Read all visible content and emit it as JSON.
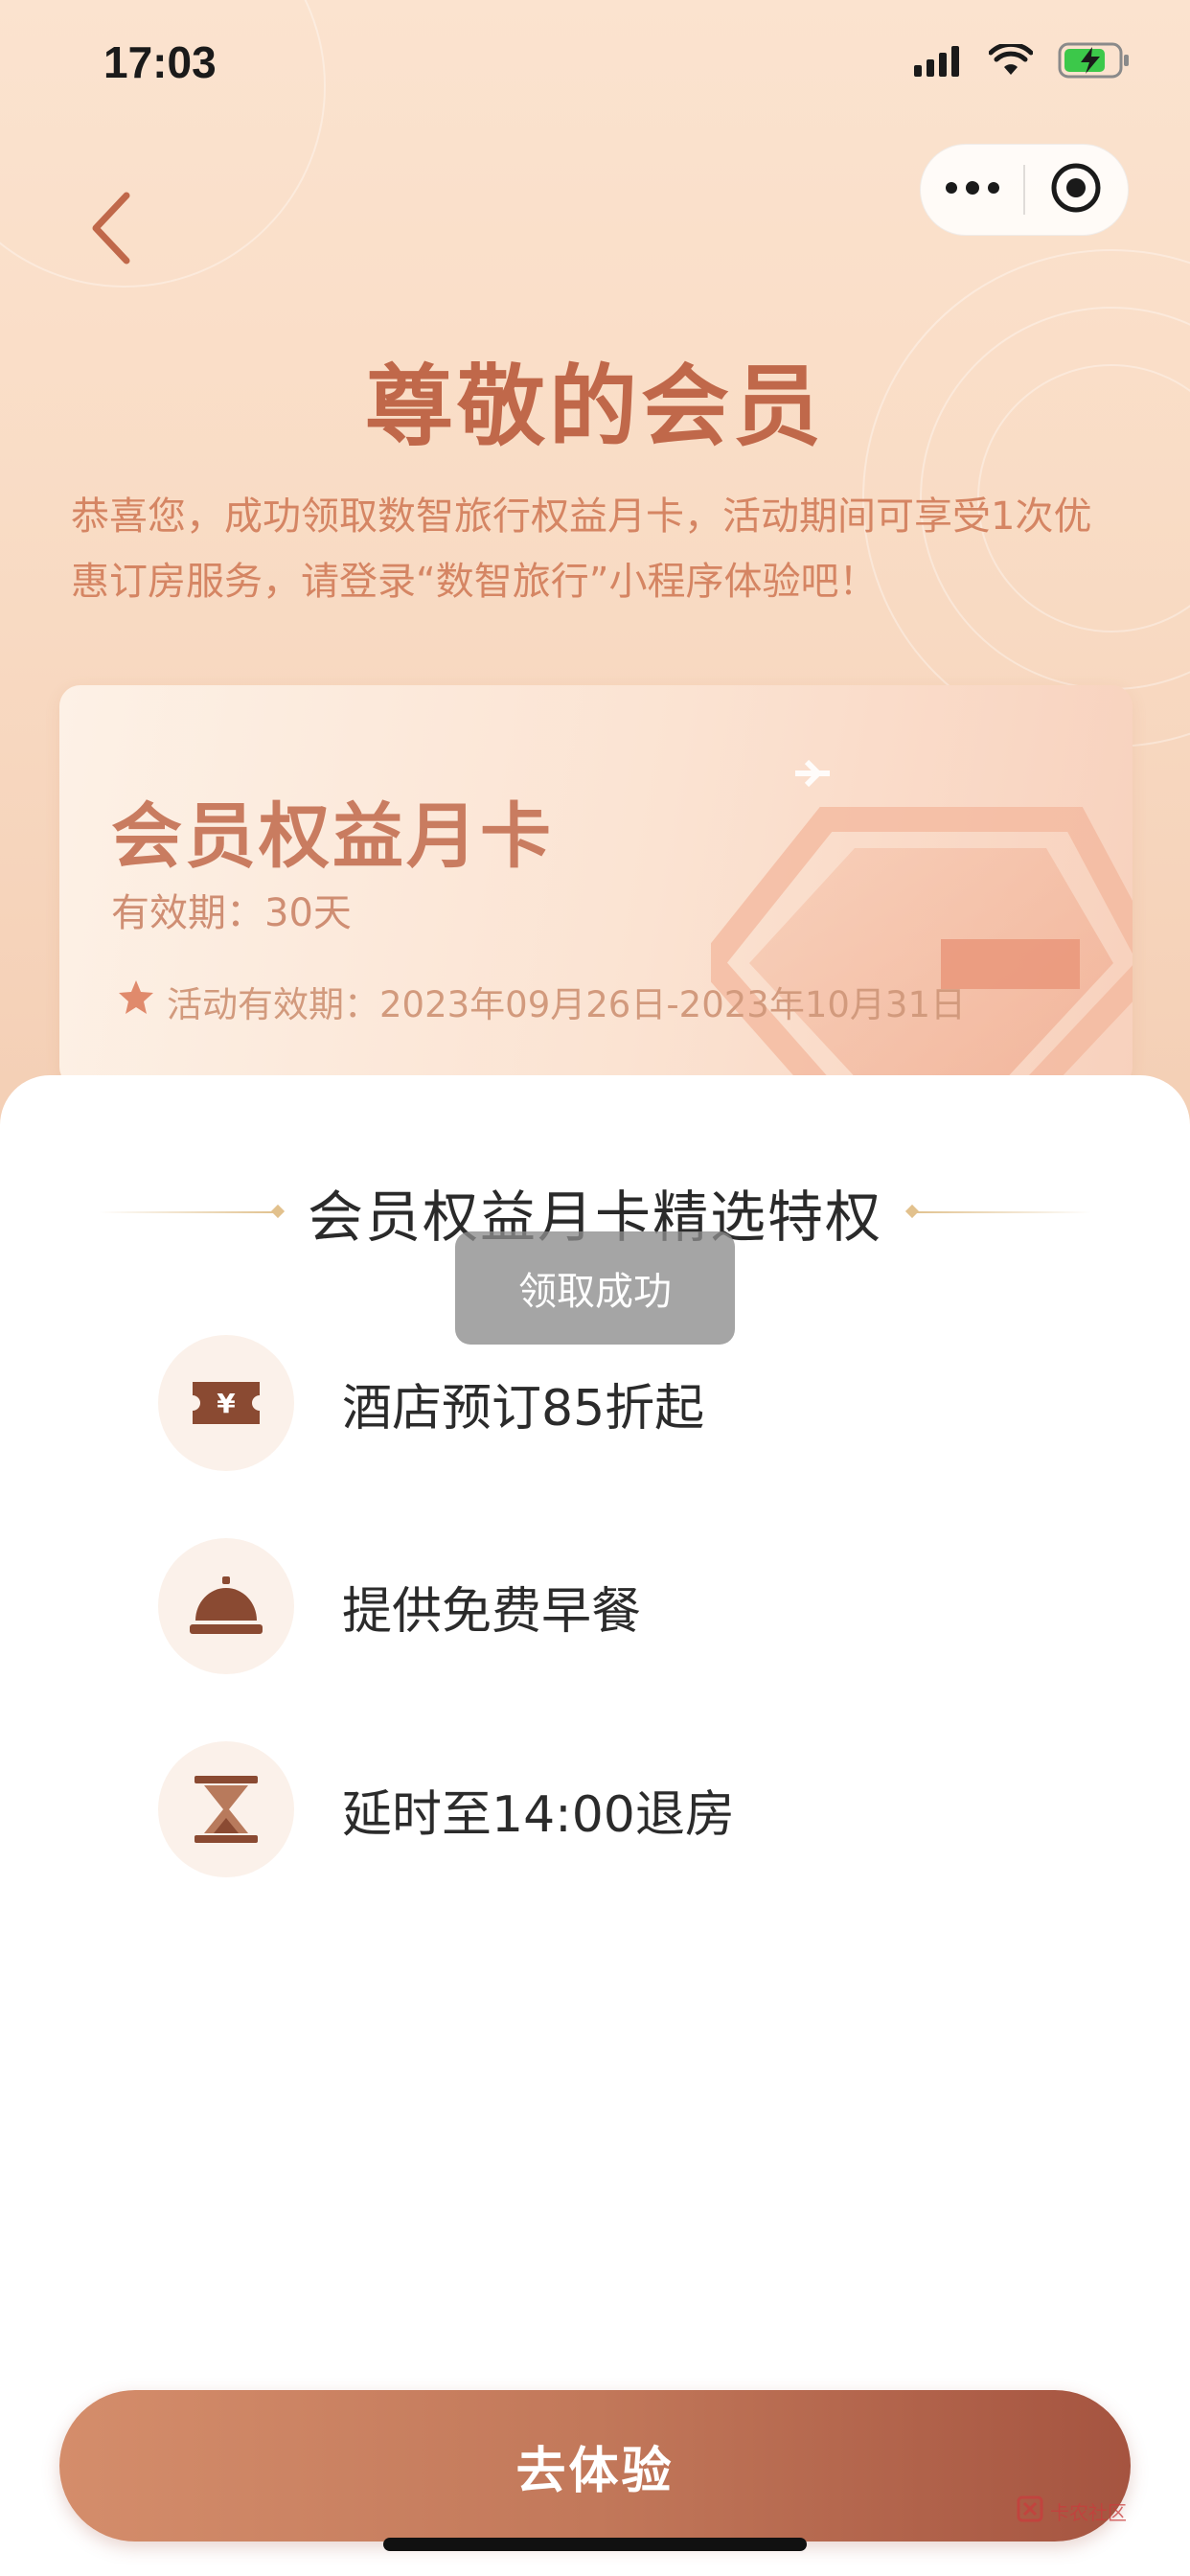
{
  "status_bar": {
    "time": "17:03"
  },
  "header": {
    "title": "尊敬的会员"
  },
  "intro": {
    "text": "恭喜您，成功领取数智旅行权益月卡，活动期间可享受1次优惠订房服务，请登录“数智旅行”小程序体验吧！"
  },
  "card": {
    "title": "会员权益月卡",
    "validity": "有效期：30天",
    "activity_period": "活动有效期：2023年09月26日-2023年10月31日"
  },
  "benefits": {
    "section_title": "会员权益月卡精选特权",
    "items": [
      {
        "label": "酒店预订85折起",
        "icon": "yuan-ticket-icon"
      },
      {
        "label": "提供免费早餐",
        "icon": "service-bell-icon"
      },
      {
        "label": "延时至14:00退房",
        "icon": "hourglass-icon"
      }
    ]
  },
  "toast": {
    "message": "领取成功"
  },
  "cta": {
    "label": "去体验"
  },
  "watermark": {
    "text": "卡农社区"
  },
  "colors": {
    "accent": "#c0684a",
    "cta_start": "#d48d6b",
    "cta_end": "#a55440",
    "header_bg": "#fbe3cf"
  }
}
